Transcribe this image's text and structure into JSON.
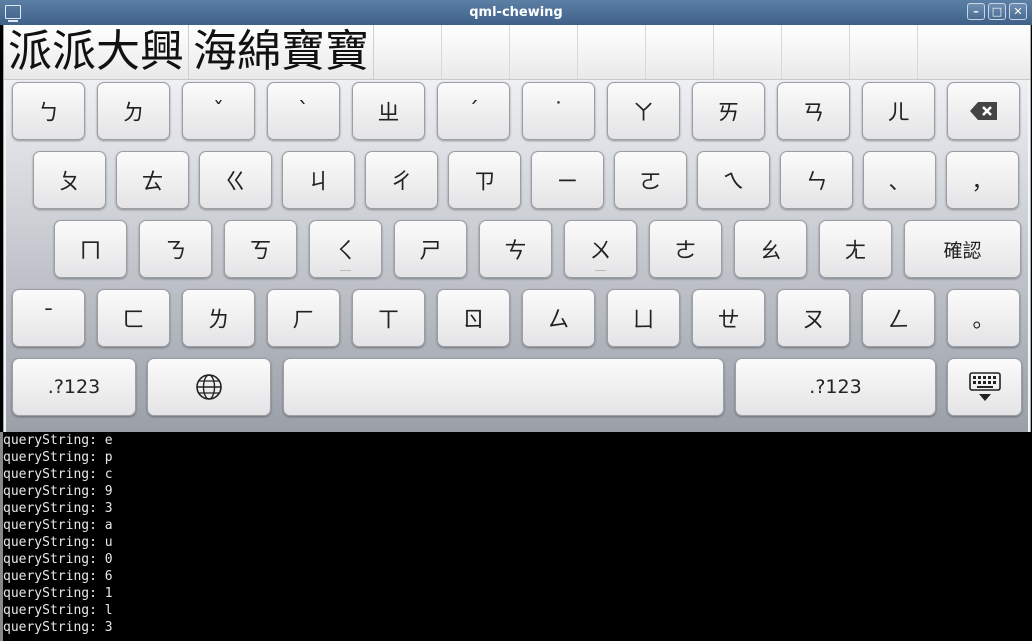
{
  "window": {
    "title": "qml-chewing",
    "buttons": [
      "minimize",
      "maximize",
      "close"
    ]
  },
  "candidates": {
    "items": [
      "派派大興",
      "海綿寶寶"
    ],
    "empty_slots": 9
  },
  "keyboard": {
    "rows": [
      [
        "ㄅ",
        "ㄉ",
        "ˇ",
        "ˋ",
        "ㄓ",
        "ˊ",
        "˙",
        "ㄚ",
        "ㄞ",
        "ㄢ",
        "ㄦ",
        "backspace"
      ],
      [
        "ㄆ",
        "ㄊ",
        "ㄍ",
        "ㄐ",
        "ㄔ",
        "ㄗ",
        "ㄧ",
        "ㄛ",
        "ㄟ",
        "ㄣ",
        "、",
        "，"
      ],
      [
        "ㄇ",
        "ㄋ",
        "ㄎ",
        "ㄑ",
        "ㄕ",
        "ㄘ",
        "ㄨ",
        "ㄜ",
        "ㄠ",
        "ㄤ",
        "確認"
      ],
      [
        "ˉ",
        "ㄈ",
        "ㄌ",
        "ㄏ",
        "ㄒ",
        "ㄖ",
        "ㄙ",
        "ㄩ",
        "ㄝ",
        "ㄡ",
        "ㄥ",
        "。"
      ],
      [
        ".?123",
        "globe",
        " ",
        ".?123",
        "hide-keyboard"
      ]
    ]
  },
  "terminal": {
    "lines": [
      "queryString: e",
      "queryString: p",
      "queryString: c",
      "queryString: 9",
      "queryString: 3",
      "queryString: a",
      "queryString: u",
      "queryString: 0",
      "queryString: 6",
      "queryString: 1",
      "queryString: l",
      "queryString: 3"
    ]
  }
}
